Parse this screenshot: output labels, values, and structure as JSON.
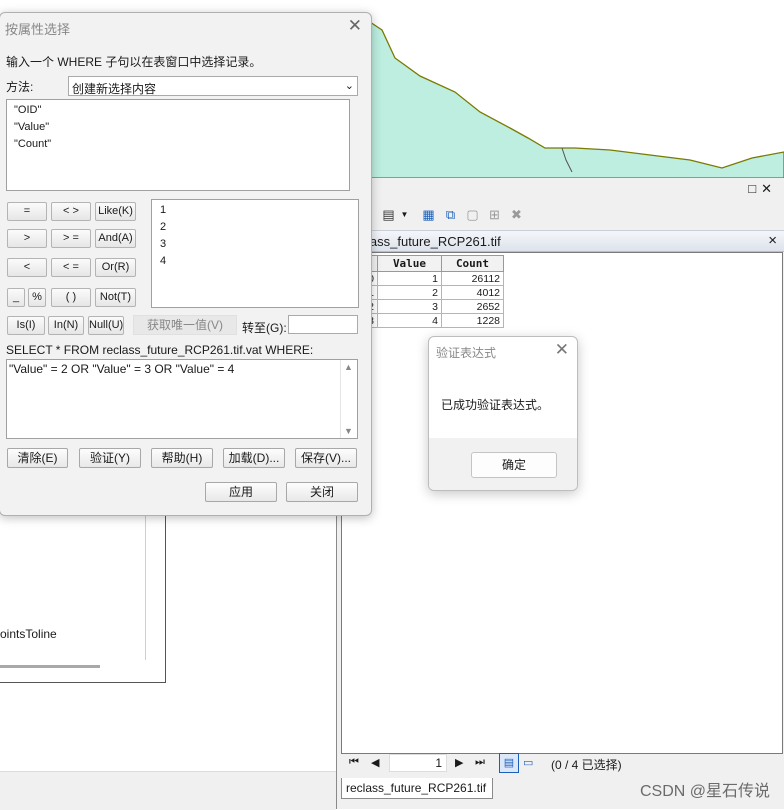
{
  "colors": {
    "map_fill": "#bdeee0",
    "map_border": "#7a7a00",
    "accent": "#0a58ca"
  },
  "left_panel": {
    "text": "ointsToline"
  },
  "attribute_table": {
    "tab_label": "lass_future_RCP261.tif",
    "toolbar_icons": [
      "table-options-icon",
      "chevron-down-icon",
      "select-by-attributes-icon",
      "switch-selection-icon",
      "clear-selection-icon",
      "zoom-to-selected-icon",
      "delete-selected-icon"
    ],
    "columns": [
      "OID",
      "Value",
      "Count"
    ],
    "rows": [
      [
        "0",
        "1",
        "26112"
      ],
      [
        "1",
        "2",
        "4012"
      ],
      [
        "2",
        "3",
        "2652"
      ],
      [
        "3",
        "4",
        "1228"
      ]
    ],
    "nav": {
      "page": "1",
      "status": "(0 / 4 已选择)"
    },
    "bottom_tab": "reclass_future_RCP261.tif"
  },
  "dialog": {
    "title": "按属性选择",
    "prompt": "输入一个 WHERE 子句以在表窗口中选择记录。",
    "method_label": "方法:",
    "method_value": "创建新选择内容",
    "fields": [
      "\"OID\"",
      "\"Value\"",
      "\"Count\""
    ],
    "operators": [
      "=",
      "< >",
      "Like(K)",
      ">",
      "> =",
      "And(A)",
      "<",
      "< =",
      "Or(R)",
      "_",
      "%",
      "( )",
      "Not(T)",
      "Is(I)",
      "In(N)",
      "Null(U)"
    ],
    "values": [
      "1",
      "2",
      "3",
      "4"
    ],
    "unique_button": "获取唯一值(V)",
    "goto_label": "转至(G):",
    "sql_label": "SELECT * FROM reclass_future_RCP261.tif.vat WHERE:",
    "sql_text": "\"Value\" = 2 OR \"Value\" = 3 OR \"Value\" = 4",
    "buttons": {
      "clear": "清除(E)",
      "verify": "验证(Y)",
      "help": "帮助(H)",
      "load": "加载(D)...",
      "save": "保存(V)...",
      "apply": "应用",
      "close": "关闭"
    }
  },
  "verify_dialog": {
    "title": "验证表达式",
    "message": "已成功验证表达式。",
    "ok": "确定"
  },
  "watermark": "CSDN @星石传说"
}
